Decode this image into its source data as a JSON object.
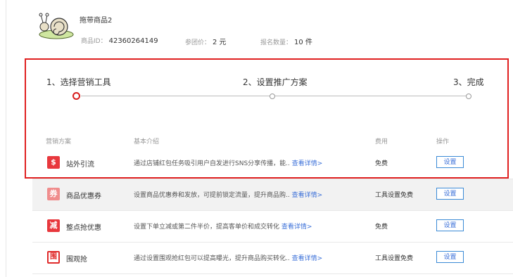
{
  "product": {
    "name": "拖带商品2",
    "id_label": "商品ID：",
    "id_value": "42360264149",
    "price_label": "参团价：",
    "price_value": "2 元",
    "count_label": "报名数量：",
    "count_value": "10 件"
  },
  "steps": [
    {
      "label": "1、选择营销工具",
      "active": true
    },
    {
      "label": "2、设置推广方案",
      "active": false
    },
    {
      "label": "3、完成",
      "active": false
    }
  ],
  "table": {
    "headers": [
      "营销方案",
      "基本介绍",
      "费用",
      "操作"
    ],
    "rows": [
      {
        "icon": "money-bag-icon",
        "glyph": "$",
        "icon_color": "#e8383d",
        "name": "站外引流",
        "desc": "通过店铺红包任务吸引用户自发进行SNS分享传播，能..",
        "link": "查看详情>",
        "fee": "免费",
        "action": "设置"
      },
      {
        "icon": "coupon-icon",
        "glyph": "券",
        "icon_color": "#f08d8d",
        "name": "商品优惠券",
        "desc": "设置商品优惠券和发放，可提前锁定流量，提升商品购..",
        "link": "查看详情>",
        "fee": "工具设置免费",
        "action": "设置"
      },
      {
        "icon": "discount-icon",
        "glyph": "减",
        "icon_color": "#e8383d",
        "name": "整点抢优惠",
        "desc": "设置下单立减或第二件半价，提高客单价和成交转化",
        "link": "查看详情>",
        "fee": "免费",
        "action": "设置"
      },
      {
        "icon": "group-buy-icon",
        "glyph": "围",
        "icon_color": "#e02b2b",
        "name": "围观抢",
        "desc": "通过设置围观抢红包可以提高曝光，提升商品购买转化..",
        "link": "查看详情>",
        "fee": "工具设置免费",
        "action": "设置"
      }
    ]
  }
}
